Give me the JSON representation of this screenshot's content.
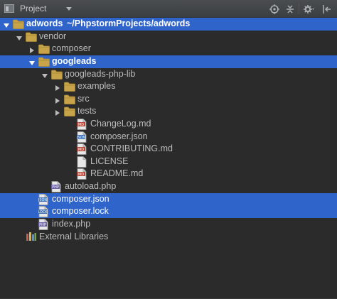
{
  "toolbar": {
    "title": "Project",
    "icons": [
      "project-icon",
      "dropdown-arrow-icon",
      "locate-target-icon",
      "collapse-all-icon",
      "gear-icon",
      "hide-pin-icon"
    ]
  },
  "tree": {
    "rows": [
      {
        "label": "adwords",
        "path": "~/PhpstormProjects/adwords",
        "type": "folder",
        "expanded": true,
        "selected": true,
        "bold": true
      },
      {
        "label": "vendor",
        "type": "folder",
        "expanded": true
      },
      {
        "label": "composer",
        "type": "folder",
        "expanded": false
      },
      {
        "label": "googleads",
        "type": "folder",
        "expanded": true,
        "selected": true,
        "bold": true
      },
      {
        "label": "googleads-php-lib",
        "type": "folder",
        "expanded": true
      },
      {
        "label": "examples",
        "type": "folder",
        "expanded": false
      },
      {
        "label": "src",
        "type": "folder",
        "expanded": false
      },
      {
        "label": "tests",
        "type": "folder",
        "expanded": false
      },
      {
        "label": "ChangeLog.md",
        "type": "md"
      },
      {
        "label": "composer.json",
        "type": "json"
      },
      {
        "label": "CONTRIBUTING.md",
        "type": "md"
      },
      {
        "label": "LICENSE",
        "type": "text"
      },
      {
        "label": "README.md",
        "type": "md"
      },
      {
        "label": "autoload.php",
        "type": "php"
      },
      {
        "label": "composer.json",
        "type": "json",
        "selected": true
      },
      {
        "label": "composer.lock",
        "type": "lock",
        "selected": true
      },
      {
        "label": "index.php",
        "type": "php"
      },
      {
        "label": "External Libraries",
        "type": "library"
      }
    ]
  },
  "colors": {
    "background": "#2b2b2b",
    "selection": "#2f65ca",
    "folder": "#c7a34a",
    "text": "#bbbbbb"
  }
}
